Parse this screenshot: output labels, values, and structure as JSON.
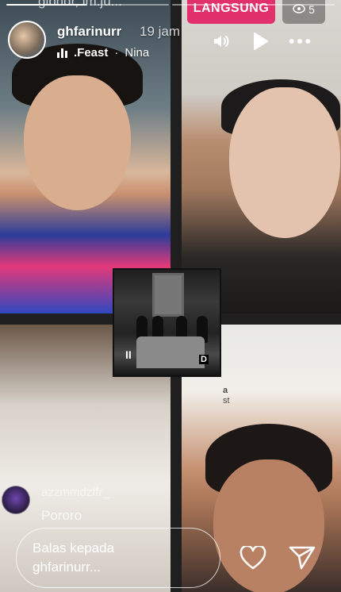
{
  "story": {
    "progress_segments": 4,
    "progress_done": 1
  },
  "underlying": {
    "ghost_title": "gibndr, im.ju...",
    "live_label": "LANGSUNG",
    "viewer_count": "5",
    "side_text_1": "a",
    "side_text_2": "st"
  },
  "header": {
    "username": "ghfarinurr",
    "timestamp": "19 jam",
    "music_artist": ".Feast",
    "music_separator": "·",
    "music_title": "Nina"
  },
  "icons": {
    "sound": "speaker-icon",
    "play": "play-icon",
    "more": "more-icon",
    "heart": "heart-icon",
    "send": "send-icon"
  },
  "album": {
    "pause_glyph": "II",
    "logo": "D"
  },
  "comment": {
    "username": "azzmmdzffr_",
    "text": "Pororo"
  },
  "reply": {
    "placeholder": "Balas kepada\nghfarinurr..."
  },
  "colors": {
    "live_badge": "#e1306c",
    "text": "#ffffff"
  }
}
